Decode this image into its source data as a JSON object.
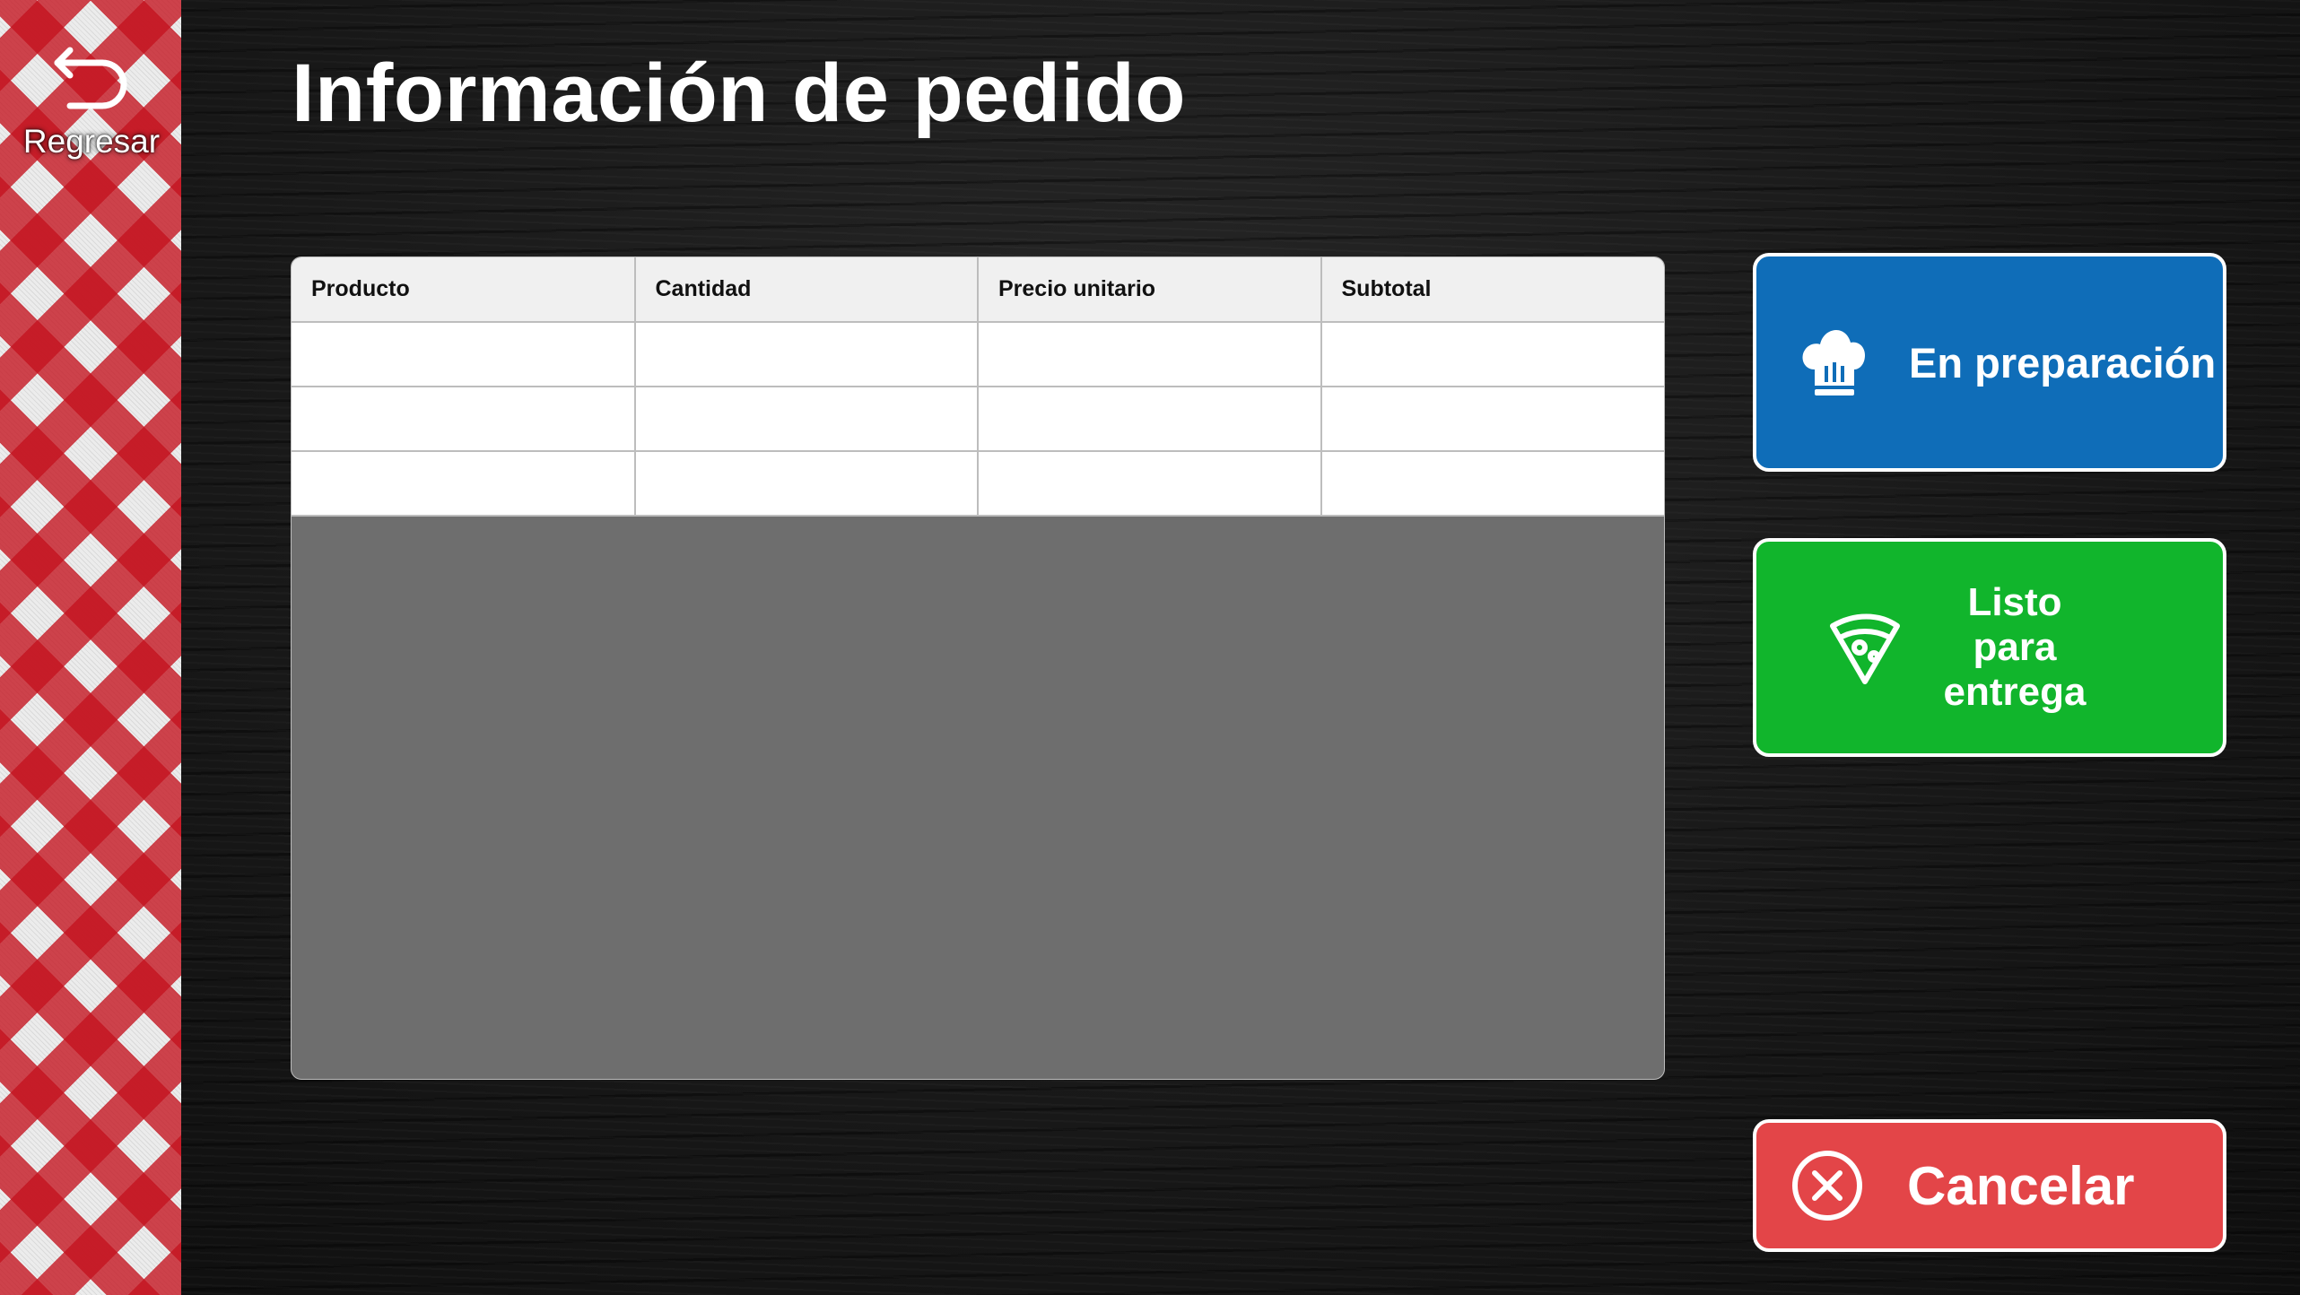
{
  "header": {
    "back_label": "Regresar",
    "back_icon": "undo-arrow-icon",
    "title": "Información de pedido"
  },
  "order_table": {
    "columns": [
      "Producto",
      "Cantidad",
      "Precio unitario",
      "Subtotal"
    ],
    "rows": [
      [
        "",
        "",
        "",
        ""
      ],
      [
        "",
        "",
        "",
        ""
      ],
      [
        "",
        "",
        "",
        ""
      ]
    ]
  },
  "actions": {
    "in_preparation": {
      "label": "En preparación",
      "icon": "chef-hat-icon",
      "color": "#0f6db8"
    },
    "ready_for_delivery": {
      "label_lines": [
        "Listo",
        "para",
        "entrega"
      ],
      "icon": "pizza-slice-icon",
      "color": "#11b52c"
    },
    "cancel": {
      "label": "Cancelar",
      "icon": "x-circle-icon",
      "color": "#e34548"
    }
  },
  "colors": {
    "accent_red": "#c4121e",
    "table_panel": "#6e6e6e"
  }
}
